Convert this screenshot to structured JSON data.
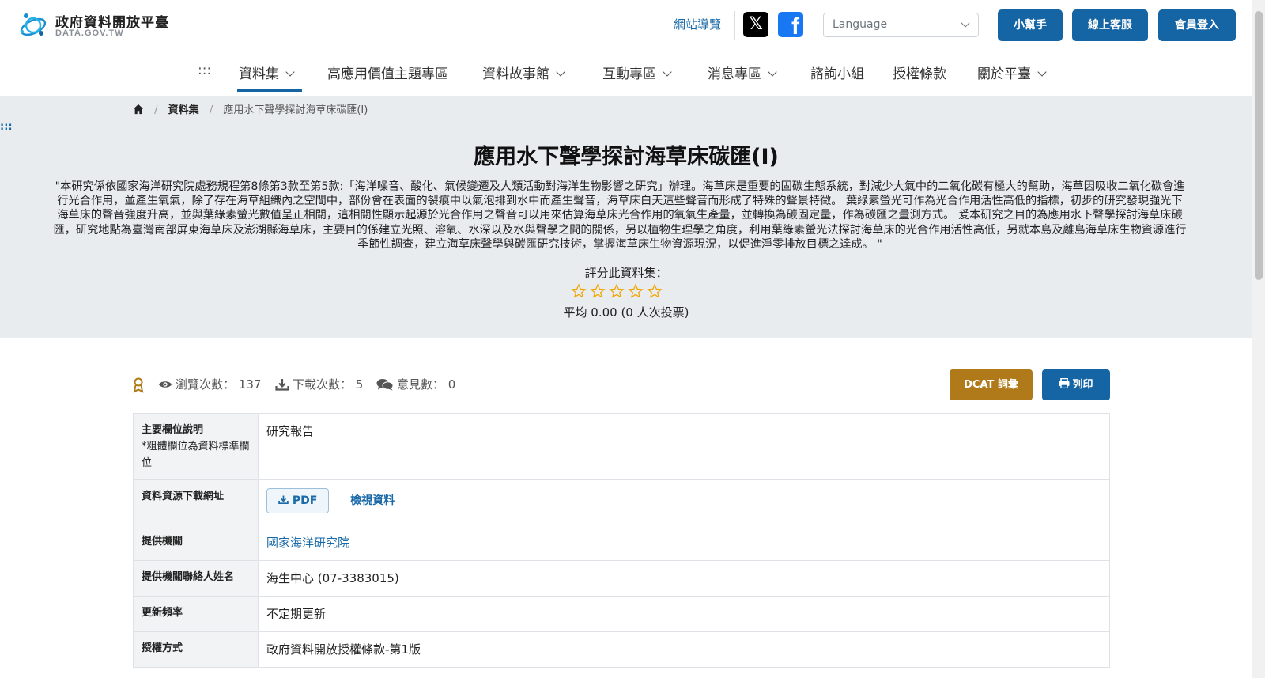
{
  "header": {
    "logo_title": "政府資料開放平臺",
    "logo_sub": "DATA.GOV.TW",
    "sitemap": "網站導覽",
    "x_glyph": "𝕏",
    "fb_glyph": "f",
    "language_placeholder": "Language",
    "buttons": [
      "小幫手",
      "線上客服",
      "會員登入"
    ]
  },
  "nav": {
    "skip": ":::",
    "items": [
      {
        "label": "資料集",
        "dropdown": true,
        "active": true
      },
      {
        "label": "高應用價值主題專區",
        "dropdown": false
      },
      {
        "label": "資料故事館",
        "dropdown": true
      },
      {
        "label": "互動專區",
        "dropdown": true
      },
      {
        "label": "消息專區",
        "dropdown": true
      },
      {
        "label": "諮詢小組",
        "dropdown": false
      },
      {
        "label": "授權條款",
        "dropdown": false
      },
      {
        "label": "關於平臺",
        "dropdown": true
      }
    ]
  },
  "breadcrumb": {
    "level1": "資料集",
    "current": "應用水下聲學探討海草床碳匯(I)",
    "sep": "/"
  },
  "side_dots": ":::",
  "dataset": {
    "title": "應用水下聲學探討海草床碳匯(I)",
    "description": "\"本研究係依國家海洋研究院處務規程第8條第3款至第5款:「海洋噪音、酸化、氣候變遷及人類活動對海洋生物影響之研究」辦理。海草床是重要的固碳生態系統，對減少大氣中的二氧化碳有極大的幫助，海草因吸收二氧化碳會進行光合作用，並產生氧氣，除了存在海草組織內之空間中，部份會在表面的裂痕中以氣泡排到水中而產生聲音，海草床白天這些聲音而形成了特殊的聲景特徵。 葉綠素螢光可作為光合作用活性高低的指標，初步的研究發現強光下海草床的聲音強度升高，並與葉綠素螢光數值呈正相關，這相關性顯示起源於光合作用之聲音可以用來估算海草床光合作用的氧氣生產量，並轉換為碳固定量，作為碳匯之量測方式。 爰本研究之目的為應用水下聲學探討海草床碳匯，研究地點為臺灣南部屏東海草床及澎湖縣海草床，主要目的係建立光照、溶氧、水深以及水與聲學之間的關係，另以植物生理學之角度，利用葉綠素螢光法探討海草床的光合作用活性高低，另就本島及離島海草床生物資源進行季節性調查，建立海草床聲學與碳匯研究技術，掌握海草床生物資源現況，以促進淨零排放目標之達成。 \"",
    "rating_label": "評分此資料集：",
    "rating_value": 0,
    "rating_max": 5,
    "rating_summary": "平均 0.00 (0 人次投票)"
  },
  "stats": {
    "views_label": "瀏覽次數：",
    "views": "137",
    "downloads_label": "下載次數：",
    "downloads": "5",
    "comments_label": "意見數：",
    "comments": "0"
  },
  "actions": {
    "dcat": "DCAT 詞彙",
    "print": "列印"
  },
  "meta": {
    "main_field_key": "主要欄位說明",
    "main_field_note": "*粗體欄位為資料標準欄位",
    "main_field_val": "研究報告",
    "download_key": "資料資源下載網址",
    "pdf_label": "PDF",
    "view_label": "檢視資料",
    "org_key": "提供機關",
    "org_val": "國家海洋研究院",
    "contact_key": "提供機關聯絡人姓名",
    "contact_val": "海生中心 (07-3383015)",
    "freq_key": "更新頻率",
    "freq_val": "不定期更新",
    "license_key": "授權方式",
    "license_val": "政府資料開放授權條款-第1版"
  },
  "colors": {
    "primary": "#1565a4",
    "dcat": "#b07a1a",
    "hero_bg": "#e9ecef",
    "star": "#f0a500"
  }
}
